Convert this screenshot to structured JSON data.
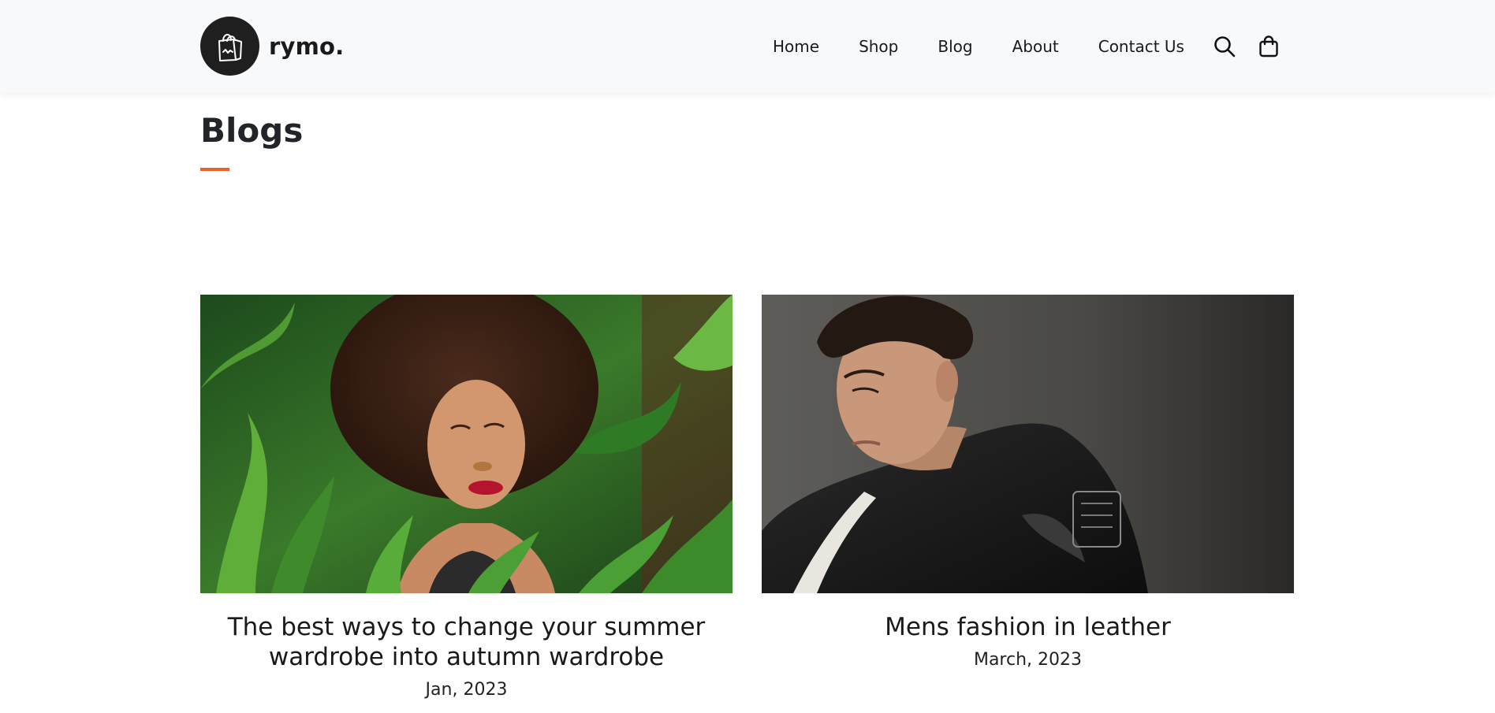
{
  "brand": {
    "name": "rymo.",
    "logo_icon": "shopping-bag-icon"
  },
  "nav": {
    "items": [
      {
        "label": "Home"
      },
      {
        "label": "Shop"
      },
      {
        "label": "Blog"
      },
      {
        "label": "About"
      },
      {
        "label": "Contact Us"
      }
    ],
    "search_icon": "search-icon",
    "cart_icon": "cart-bag-icon"
  },
  "page": {
    "title": "Blogs",
    "accent_color": "#e8632b"
  },
  "posts": [
    {
      "title": "The best ways to change your summer wardrobe into autumn wardrobe",
      "date": "Jan, 2023",
      "image": "woman-in-green-leaves-photo"
    },
    {
      "title": "Mens fashion in leather",
      "date": "March, 2023",
      "image": "man-in-leather-jacket-photo"
    }
  ]
}
